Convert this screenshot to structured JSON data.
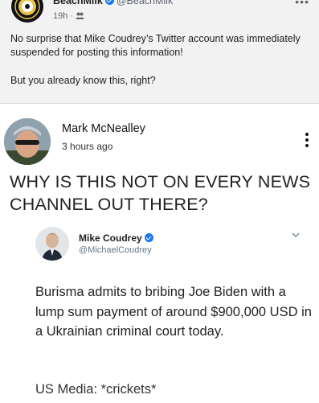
{
  "post": {
    "author": "BeachMilk",
    "handle": "@BeachMilk",
    "time": "19h",
    "separator": "·",
    "menu_glyph": "•••",
    "text_line1": "No surprise that Mike Coudrey’s Twitter account was immediately suspended for posting this information!",
    "text_line2": "But you already know this, right?"
  },
  "shared_post": {
    "author": "Mark McNealley",
    "time": "3 hours ago",
    "headline": "WHY IS THIS NOT ON EVERY NEWS CHANNEL OUT THERE?"
  },
  "tweet": {
    "name": "Mike Coudrey",
    "handle": "@MichaelCoudrey",
    "body": "Burisma admits to bribing Joe Biden with a lump sum payment of around $900,000 USD in a Ukrainian criminal court today.",
    "extra": "US Media: *crickets*"
  },
  "icons": {
    "page_avatar": "seal-logo-icon",
    "verified": "verified-badge-icon",
    "privacy": "friends-icon",
    "more": "more-dots-icon",
    "kebab": "kebab-menu-icon",
    "chevron": "chevron-down-icon"
  },
  "colors": {
    "verified": "#1877f2",
    "background": "#f2f2f2",
    "card": "#ffffff"
  }
}
